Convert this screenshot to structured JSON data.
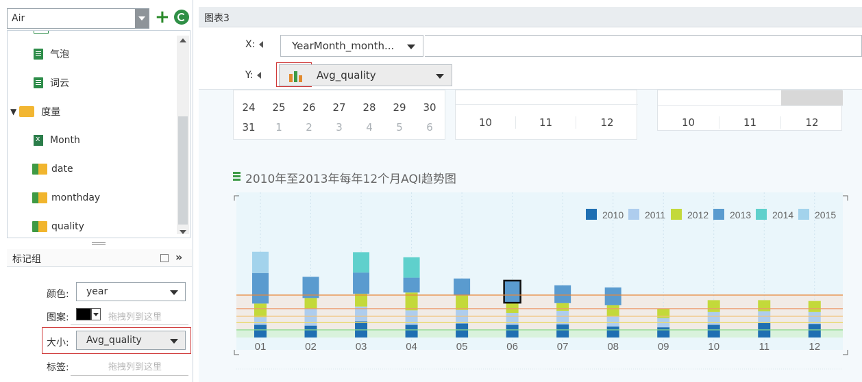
{
  "datasource": {
    "value": "Air"
  },
  "tree": {
    "items": [
      {
        "label": "气泡"
      },
      {
        "label": "词云"
      },
      {
        "label": "度量"
      },
      {
        "label": "Month"
      },
      {
        "label": "date"
      },
      {
        "label": "monthday"
      },
      {
        "label": "quality"
      }
    ]
  },
  "marks": {
    "title": "标记组",
    "color_label": "颜色:",
    "color_value": "year",
    "pattern_label": "图案:",
    "pattern_hint": "拖拽列到这里",
    "size_label": "大小:",
    "size_value": "Avg_quality",
    "tag_label": "标签:",
    "tag_hint": "拖拽列到这里"
  },
  "chart_panel": {
    "title": "图表3",
    "x_label": "X:",
    "x_value": "YearMonth_month...",
    "y_label": "Y:",
    "y_value": "Avg_quality"
  },
  "calendar": {
    "row1": [
      "24",
      "25",
      "26",
      "27",
      "28",
      "29",
      "30"
    ],
    "row2": [
      "31",
      "1",
      "2",
      "3",
      "4",
      "5",
      "6"
    ]
  },
  "month_grid_1": [
    "10",
    "11",
    "12"
  ],
  "month_grid_2": [
    "10",
    "11",
    "12"
  ],
  "chart_data": {
    "type": "bar",
    "title": "2010年至2013年每年12个月AQI趋势图",
    "categories": [
      "01",
      "02",
      "03",
      "04",
      "05",
      "06",
      "07",
      "08",
      "09",
      "10",
      "11",
      "12"
    ],
    "legend": [
      "2010",
      "2011",
      "2012",
      "2013",
      "2014",
      "2015"
    ],
    "legend_placement": "top-right",
    "colors": {
      "2010": "#1f6fb2",
      "2011": "#aecdee",
      "2012": "#c3d93a",
      "2013": "#5a9bcf",
      "2014": "#5fd0cc",
      "2015": "#a3d3ec"
    },
    "series": [
      {
        "name": "2010",
        "values": [
          30,
          28,
          38,
          30,
          33,
          30,
          31,
          26,
          24,
          30,
          36,
          32
        ]
      },
      {
        "name": "2011",
        "values": [
          18,
          40,
          35,
          34,
          32,
          28,
          32,
          24,
          22,
          30,
          26,
          28
        ]
      },
      {
        "name": "2012",
        "values": [
          32,
          25,
          30,
          42,
          34,
          24,
          18,
          26,
          22,
          28,
          26,
          26
        ]
      },
      {
        "name": "2013",
        "values": [
          72,
          50,
          50,
          35,
          40,
          52,
          42,
          42,
          0,
          0,
          0,
          0
        ]
      },
      {
        "name": "2014",
        "values": [
          0,
          0,
          48,
          48,
          0,
          0,
          0,
          0,
          0,
          0,
          0,
          0
        ]
      },
      {
        "name": "2015",
        "values": [
          50,
          0,
          0,
          0,
          0,
          0,
          0,
          0,
          0,
          0,
          0,
          0
        ]
      }
    ],
    "reference_lines": [
      {
        "color": "#e8883a",
        "value": 100
      },
      {
        "color": "#ec9a6a",
        "value": 68
      },
      {
        "color": "#f1c27a",
        "value": 50
      },
      {
        "color": "#e9d86a",
        "value": 35
      },
      {
        "color": "#8bd98b",
        "value": 18
      }
    ],
    "highlighted_category": "06",
    "highlighted_series": "2013"
  }
}
